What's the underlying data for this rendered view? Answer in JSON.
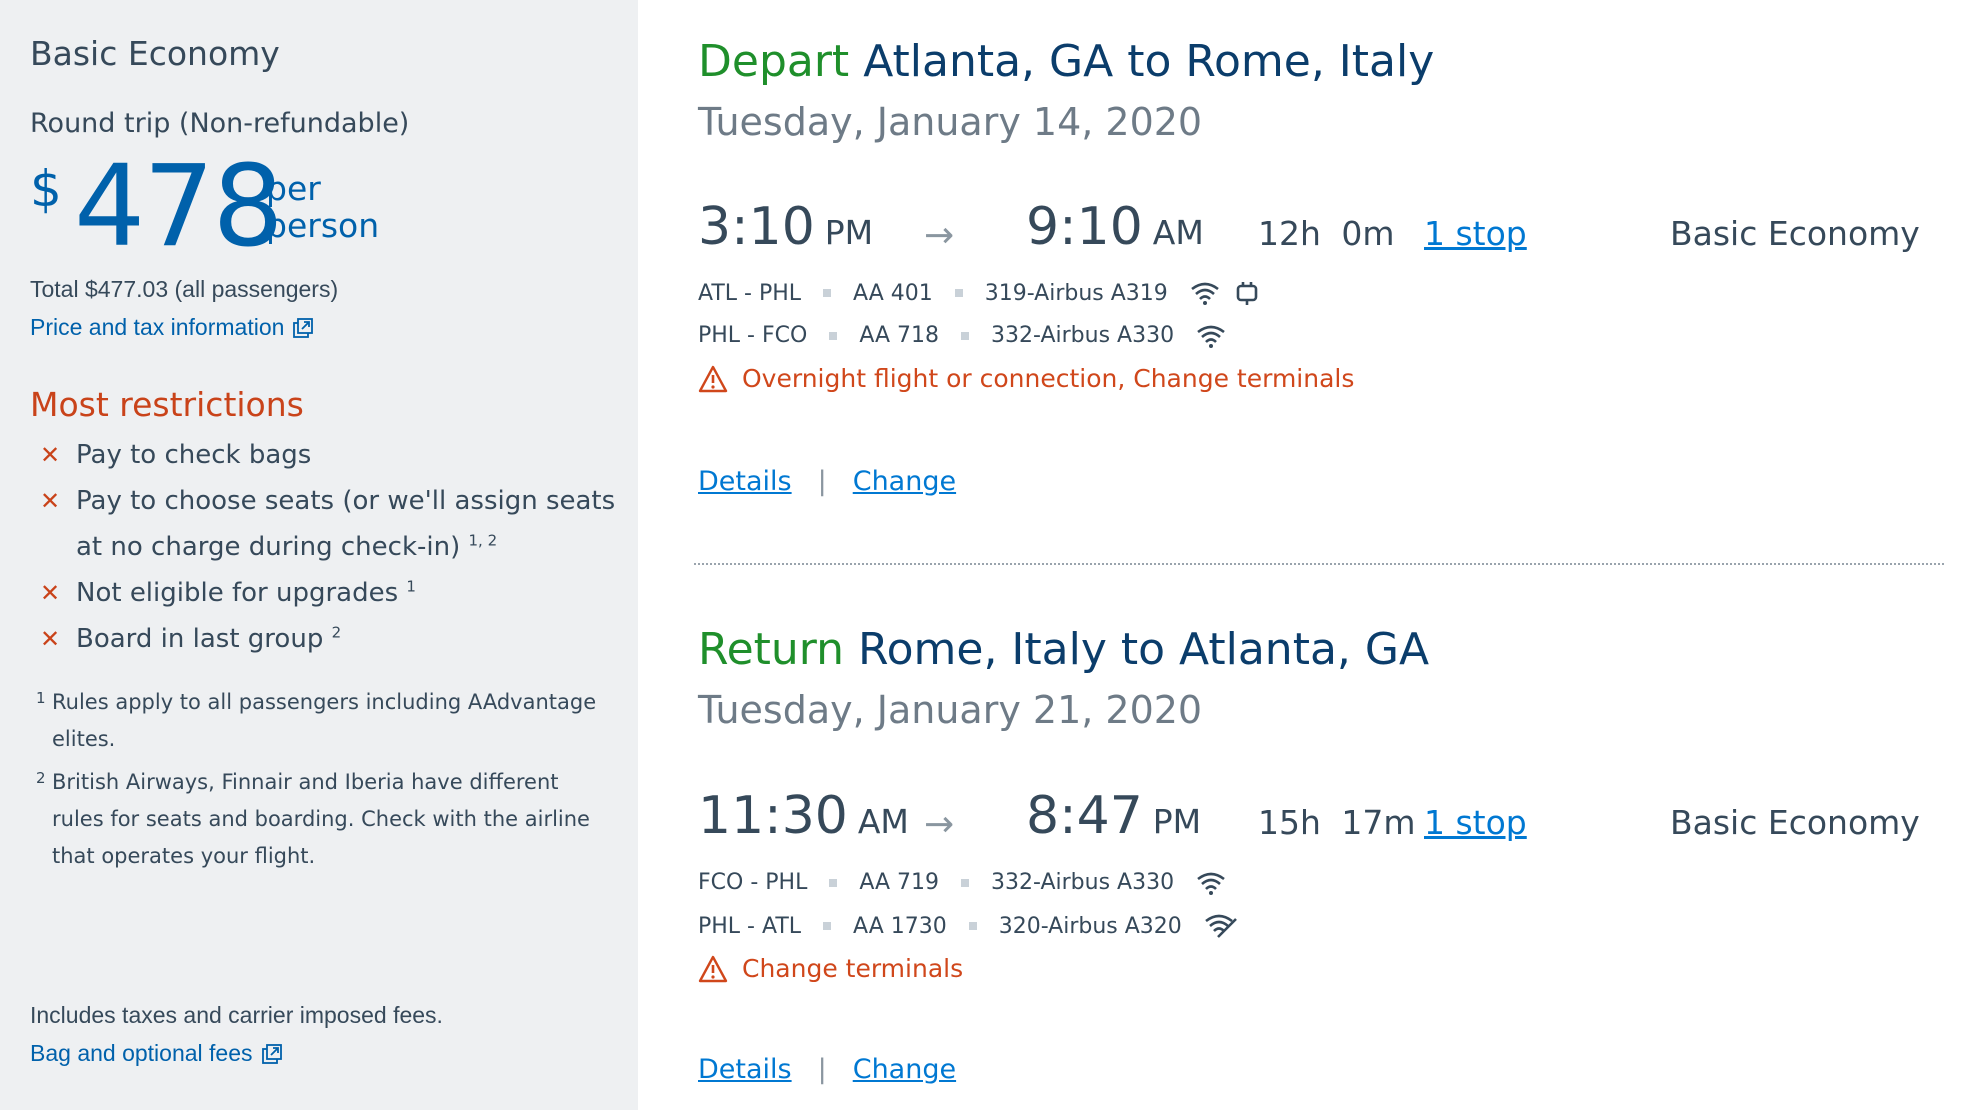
{
  "fare": {
    "title": "Basic Economy",
    "trip_type": "Round trip (Non-refundable)",
    "currency_symbol": "$",
    "price": "478",
    "per_label": "per",
    "person_label": "person",
    "total": "Total $477.03 (all passengers)",
    "price_tax_link": "Price and tax information",
    "restrictions_title": "Most restrictions",
    "restrictions": [
      {
        "text": "Pay to check bags",
        "sup": ""
      },
      {
        "text": "Pay to choose seats (or we'll assign seats at no charge during check-in)",
        "sup": "1, 2"
      },
      {
        "text": "Not eligible for upgrades",
        "sup": "1"
      },
      {
        "text": "Board in last group",
        "sup": "2"
      }
    ],
    "notes": [
      {
        "num": "1",
        "text": "Rules apply to all passengers including AAdvantage elites."
      },
      {
        "num": "2",
        "text": "British Airways, Finnair and Iberia have different rules for seats and boarding. Check with the airline that operates your flight."
      }
    ],
    "fees_text": "Includes taxes and carrier imposed fees.",
    "bag_fees_link": "Bag and optional fees",
    "colors": {
      "price_blue": "#0061ab",
      "restriction_orange": "#c9431a",
      "sidebar_bg": "#eef0f2"
    }
  },
  "trips": [
    {
      "keyword": "Depart",
      "route": "Atlanta, GA to Rome, Italy",
      "date": "Tuesday, January 14, 2020",
      "depart_time": "3:10",
      "depart_ampm": "PM",
      "arrive_time": "9:10",
      "arrive_ampm": "AM",
      "arrow": "→",
      "duration": "12h 0m",
      "stops": "1 stop",
      "cabin": "Basic Economy",
      "segments": [
        {
          "route": "ATL - PHL",
          "flight": "AA 401",
          "aircraft": "319-Airbus A319",
          "amenities": [
            "wifi-icon",
            "power-outlet-icon"
          ]
        },
        {
          "route": "PHL - FCO",
          "flight": "AA 718",
          "aircraft": "332-Airbus A330",
          "amenities": [
            "wifi-icon"
          ]
        }
      ],
      "warning": "Overnight flight or connection, Change terminals",
      "details_label": "Details",
      "separator": "|",
      "change_label": "Change"
    },
    {
      "keyword": "Return",
      "route": "Rome, Italy to Atlanta, GA",
      "date": "Tuesday, January 21, 2020",
      "depart_time": "11:30",
      "depart_ampm": "AM",
      "arrive_time": "8:47",
      "arrive_ampm": "PM",
      "arrow": "→",
      "duration": "15h 17m",
      "stops": "1 stop",
      "cabin": "Basic Economy",
      "segments": [
        {
          "route": "FCO - PHL",
          "flight": "AA 719",
          "aircraft": "332-Airbus A330",
          "amenities": [
            "wifi-icon"
          ]
        },
        {
          "route": "PHL - ATL",
          "flight": "AA 1730",
          "aircraft": "320-Airbus A320",
          "amenities": [
            "wifi-icon"
          ]
        }
      ],
      "warning": "Change terminals",
      "details_label": "Details",
      "separator": "|",
      "change_label": "Change"
    }
  ]
}
